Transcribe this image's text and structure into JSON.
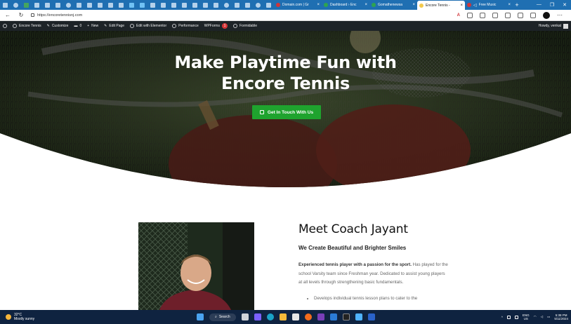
{
  "browser": {
    "tabs": [
      {
        "label": "Domain.com | Gr",
        "color": "#d13438"
      },
      {
        "label": "Dashboard › Enc",
        "color": "#2ea44f"
      },
      {
        "label": "Gomathenewsa",
        "color": "#2ea44f"
      },
      {
        "label": "Encore Tennis -",
        "color": "#f2c94c",
        "active": true
      },
      {
        "label": "Free Music",
        "color": "#d13438"
      }
    ],
    "new_tab": "+",
    "url": "https://encoretennisnj.com"
  },
  "wp_admin_bar": {
    "site_name": "Encore Tennis",
    "customize": "Customize",
    "comments": "0",
    "new": "New",
    "edit_page": "Edit Page",
    "edit_elementor": "Edit with Elementor",
    "performance": "Performance",
    "wpforms": "WPForms",
    "wpforms_count": "1",
    "formidable": "Formidable",
    "howdy": "Howdy, venkat"
  },
  "hero": {
    "title_line1": "Make Playtime Fun with",
    "title_line2": "Encore Tennis",
    "cta": "Get In Touch With Us"
  },
  "about": {
    "heading": "Meet Coach Jayant",
    "subheading": "We Create Beautiful and Brighter Smiles",
    "para_bold": "Experienced tennis player with a passion for the sport.",
    "para_rest": " Has played for the school Varsity team since Freshman year. Dedicated to assist young players at all levels through strengthening basic fundamentals.",
    "bullet1": "Develops individual tennis lesson plans to cater to the"
  },
  "taskbar": {
    "temp": "32°C",
    "weather": "Mostly sunny",
    "search": "Search",
    "lang1": "ENG",
    "lang2": "US",
    "time": "5:38 PM",
    "date": "5/11/2024"
  }
}
